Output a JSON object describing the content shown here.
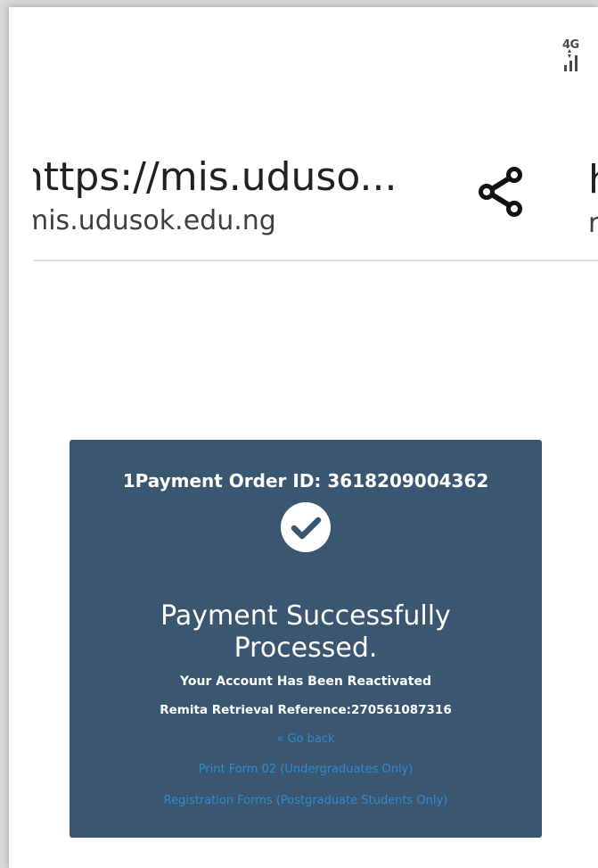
{
  "status_bar": {
    "network_label": "4G",
    "signal_icon": "signal-bars-icon"
  },
  "browser": {
    "page_title": "https://mis.uduso...",
    "host": "mis.udusok.edu.ng",
    "share_icon": "share-icon",
    "clipped_title_char": "h",
    "clipped_host_char": "r"
  },
  "card": {
    "order_id": "1Payment Order ID: 3618209004362",
    "status_icon": "check-circle-icon",
    "title_line1": "Payment Successfully",
    "title_line2": "Processed.",
    "message": "Your Account Has Been Reactivated",
    "rrr": "Remita Retrieval Reference:270561087316",
    "links": {
      "go_back": "« Go back",
      "print_form": "Print Form 02 (Undergraduates Only)",
      "registration_forms": "Registration Forms (Postgraduate Students Only)"
    }
  },
  "colors": {
    "card_background": "#3b5670",
    "link": "#2f8bd0"
  }
}
